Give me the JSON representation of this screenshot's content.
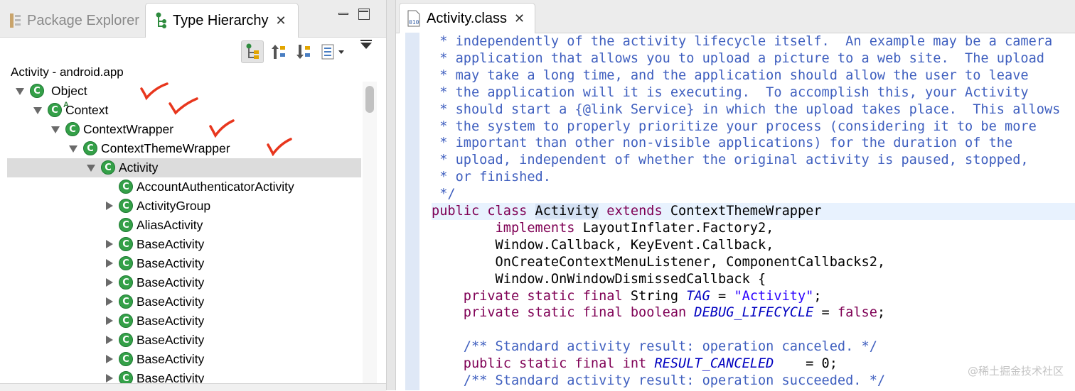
{
  "left_pane": {
    "tabs": [
      {
        "label": "Package Explorer",
        "icon": "package-explorer-icon",
        "active": false
      },
      {
        "label": "Type Hierarchy",
        "icon": "type-hierarchy-icon",
        "active": true
      }
    ],
    "close_glyph": "✕",
    "hierarchy_label": "Activity - android.app",
    "tree": [
      {
        "label": "Object",
        "expanded": true
      },
      {
        "label": "Context",
        "expanded": true,
        "abstract": true
      },
      {
        "label": "ContextWrapper",
        "expanded": true
      },
      {
        "label": "ContextThemeWrapper",
        "expanded": true
      },
      {
        "label": "Activity",
        "expanded": true,
        "selected": true
      },
      {
        "label": "AccountAuthenticatorActivity"
      },
      {
        "label": "ActivityGroup",
        "collapsed": true
      },
      {
        "label": "AliasActivity"
      },
      {
        "label": "BaseActivity",
        "collapsed": true
      },
      {
        "label": "BaseActivity",
        "collapsed": true
      },
      {
        "label": "BaseActivity",
        "collapsed": true
      },
      {
        "label": "BaseActivity",
        "collapsed": true
      },
      {
        "label": "BaseActivity",
        "collapsed": true
      },
      {
        "label": "BaseActivity",
        "collapsed": true
      },
      {
        "label": "BaseActivity",
        "collapsed": true
      },
      {
        "label": "BaseActivity",
        "collapsed": true
      }
    ],
    "class_icon_glyph": "C",
    "abstract_glyph": "A",
    "annotation_color": "#e8361d"
  },
  "editor": {
    "tab_label": "Activity.class",
    "tab_icon": "class-file-icon",
    "code_lines": [
      [
        {
          "t": "c",
          "s": " * independently of the activity lifecycle itself.  An example may be a camera"
        }
      ],
      [
        {
          "t": "c",
          "s": " * application that allows you to upload a picture to a web site.  The upload"
        }
      ],
      [
        {
          "t": "c",
          "s": " * may take a long time, and the application should allow the user to leave"
        }
      ],
      [
        {
          "t": "c",
          "s": " * the application will it is executing.  To accomplish this, your Activity"
        }
      ],
      [
        {
          "t": "c",
          "s": " * should start a {@link Service} in which the upload takes place.  This allows"
        }
      ],
      [
        {
          "t": "c",
          "s": " * the system to properly prioritize your process (considering it to be more"
        }
      ],
      [
        {
          "t": "c",
          "s": " * important than other non-visible applications) for the duration of the"
        }
      ],
      [
        {
          "t": "c",
          "s": " * upload, independent of whether the original activity is paused, stopped,"
        }
      ],
      [
        {
          "t": "c",
          "s": " * or finished."
        }
      ],
      [
        {
          "t": "c",
          "s": " */"
        }
      ],
      [
        {
          "t": "k",
          "s": "public class "
        },
        {
          "t": "h",
          "s": "Activity"
        },
        {
          "t": "k",
          "s": " extends "
        },
        {
          "t": "p",
          "s": "ContextThemeWrapper"
        }
      ],
      [
        {
          "t": "p",
          "s": "        "
        },
        {
          "t": "k",
          "s": "implements "
        },
        {
          "t": "p",
          "s": "LayoutInflater.Factory2,"
        }
      ],
      [
        {
          "t": "p",
          "s": "        Window.Callback, KeyEvent.Callback,"
        }
      ],
      [
        {
          "t": "p",
          "s": "        OnCreateContextMenuListener, ComponentCallbacks2,"
        }
      ],
      [
        {
          "t": "p",
          "s": "        Window.OnWindowDismissedCallback {"
        }
      ],
      [
        {
          "t": "p",
          "s": "    "
        },
        {
          "t": "k",
          "s": "private static final "
        },
        {
          "t": "p",
          "s": "String "
        },
        {
          "t": "i",
          "s": "TAG"
        },
        {
          "t": "p",
          "s": " = "
        },
        {
          "t": "s",
          "s": "\"Activity\""
        },
        {
          "t": "p",
          "s": ";"
        }
      ],
      [
        {
          "t": "p",
          "s": "    "
        },
        {
          "t": "k",
          "s": "private static final boolean "
        },
        {
          "t": "i",
          "s": "DEBUG_LIFECYCLE"
        },
        {
          "t": "p",
          "s": " = "
        },
        {
          "t": "k",
          "s": "false"
        },
        {
          "t": "p",
          "s": ";"
        }
      ],
      [
        {
          "t": "p",
          "s": ""
        }
      ],
      [
        {
          "t": "p",
          "s": "    "
        },
        {
          "t": "c",
          "s": "/** Standard activity result: operation canceled. */"
        }
      ],
      [
        {
          "t": "p",
          "s": "    "
        },
        {
          "t": "k",
          "s": "public static final int "
        },
        {
          "t": "i",
          "s": "RESULT_CANCELED"
        },
        {
          "t": "p",
          "s": "    = 0;"
        }
      ],
      [
        {
          "t": "p",
          "s": "    "
        },
        {
          "t": "c",
          "s": "/** Standard activity result: operation succeeded. */"
        }
      ]
    ],
    "watermark": "@稀土掘金技术社区"
  }
}
